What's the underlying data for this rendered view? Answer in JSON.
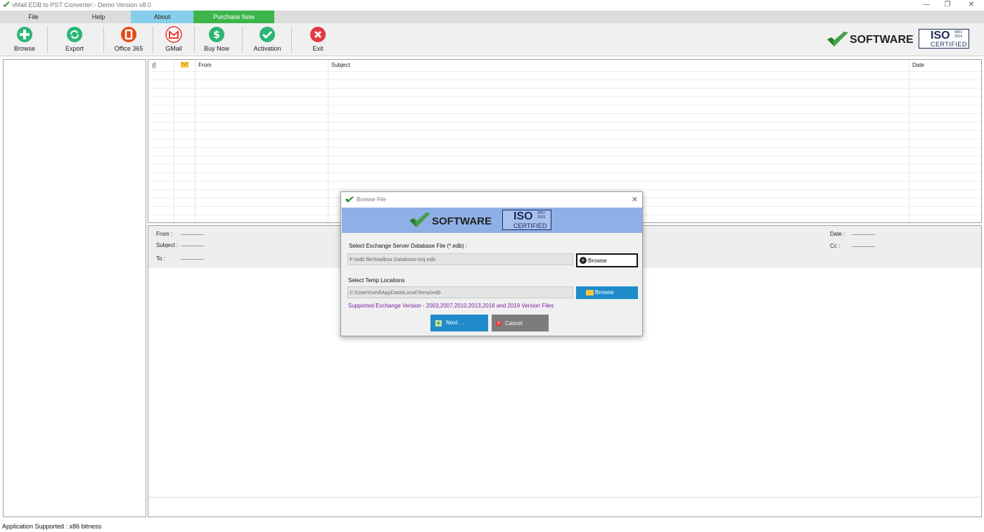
{
  "window": {
    "title": "vMail EDB to PST Converter:- Demo Version v8.0",
    "minimize": "—",
    "restore": "❐",
    "close": "✕"
  },
  "menu": {
    "file": "File",
    "help": "Help",
    "about": "About",
    "purchase": "Purchase Now"
  },
  "toolbar": {
    "browse": "Browse",
    "export": "Export",
    "office365": "Office 365",
    "gmail": "GMail",
    "buy_now": "Buy Now",
    "activation": "Activation",
    "exit": "Exit"
  },
  "brand": {
    "software": "SOFTWARE",
    "iso": "ISO",
    "iso_num1": "9001",
    "iso_num2": "2015",
    "certified": "CERTIFIED"
  },
  "grid": {
    "headers": {
      "from": "From",
      "subject": "Subject",
      "date": "Date"
    }
  },
  "preview": {
    "from": "From :",
    "subject": "Subject :",
    "to": "To :",
    "date": "Date :",
    "cc": "Cc :"
  },
  "dialog": {
    "title": "Browse File",
    "close": "✕",
    "edb_label": "Select Exchange Server Database File (*.edb) :",
    "edb_value": "F:\\edb file\\Mailbox Database-tcq.edb",
    "browse1": "Browse",
    "temp_label": "Select Temp Locations",
    "temp_value": "C:\\Users\\ved\\AppData\\Local\\Temp\\edb",
    "browse2": "Browse",
    "supported": "Supported Exchange Version - 2003,2007,2010,2013,2016 and 2019 Version Files",
    "next": "Next . . .",
    "cancel": "Cancel"
  },
  "status": {
    "text": "Application Supported :  x86 bitness"
  },
  "colors": {
    "menu_about": "#87ceeb",
    "menu_purchase": "#3cb54a",
    "dialog_banner": "#8fb0e6",
    "button_blue": "#1f8bc9",
    "supported_text": "#7b1fa2"
  }
}
